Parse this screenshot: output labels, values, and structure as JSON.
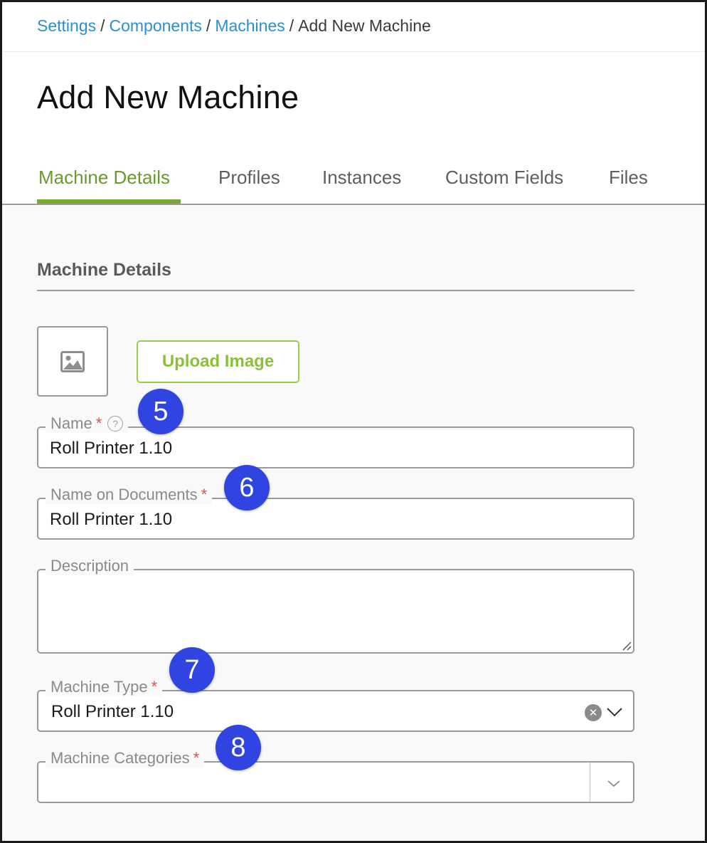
{
  "breadcrumb": {
    "items": [
      "Settings",
      "Components",
      "Machines"
    ],
    "separator": "/",
    "current": "Add New Machine"
  },
  "page_title": "Add New Machine",
  "tabs": [
    {
      "label": "Machine Details",
      "active": true
    },
    {
      "label": "Profiles",
      "active": false
    },
    {
      "label": "Instances",
      "active": false
    },
    {
      "label": "Custom Fields",
      "active": false
    },
    {
      "label": "Files",
      "active": false
    }
  ],
  "section_title": "Machine Details",
  "image": {
    "icon": "image-icon",
    "upload_label": "Upload Image"
  },
  "fields": {
    "name": {
      "label": "Name",
      "required_mark": "*",
      "help_glyph": "?",
      "value": "Roll Printer 1.10"
    },
    "name_on_documents": {
      "label": "Name on Documents",
      "required_mark": "*",
      "value": "Roll Printer 1.10"
    },
    "description": {
      "label": "Description",
      "value": ""
    },
    "machine_type": {
      "label": "Machine Type",
      "required_mark": "*",
      "value": "Roll Printer 1.10",
      "clear_glyph": "✕"
    },
    "machine_categories": {
      "label": "Machine Categories",
      "required_mark": "*",
      "value": ""
    }
  },
  "callouts": [
    "5",
    "6",
    "7",
    "8"
  ],
  "colors": {
    "link": "#2b8fd0",
    "active_tab": "#6a9a2a",
    "upload_accent": "#8cc03a",
    "required": "#d9534f",
    "callout": "#2f44e0"
  }
}
